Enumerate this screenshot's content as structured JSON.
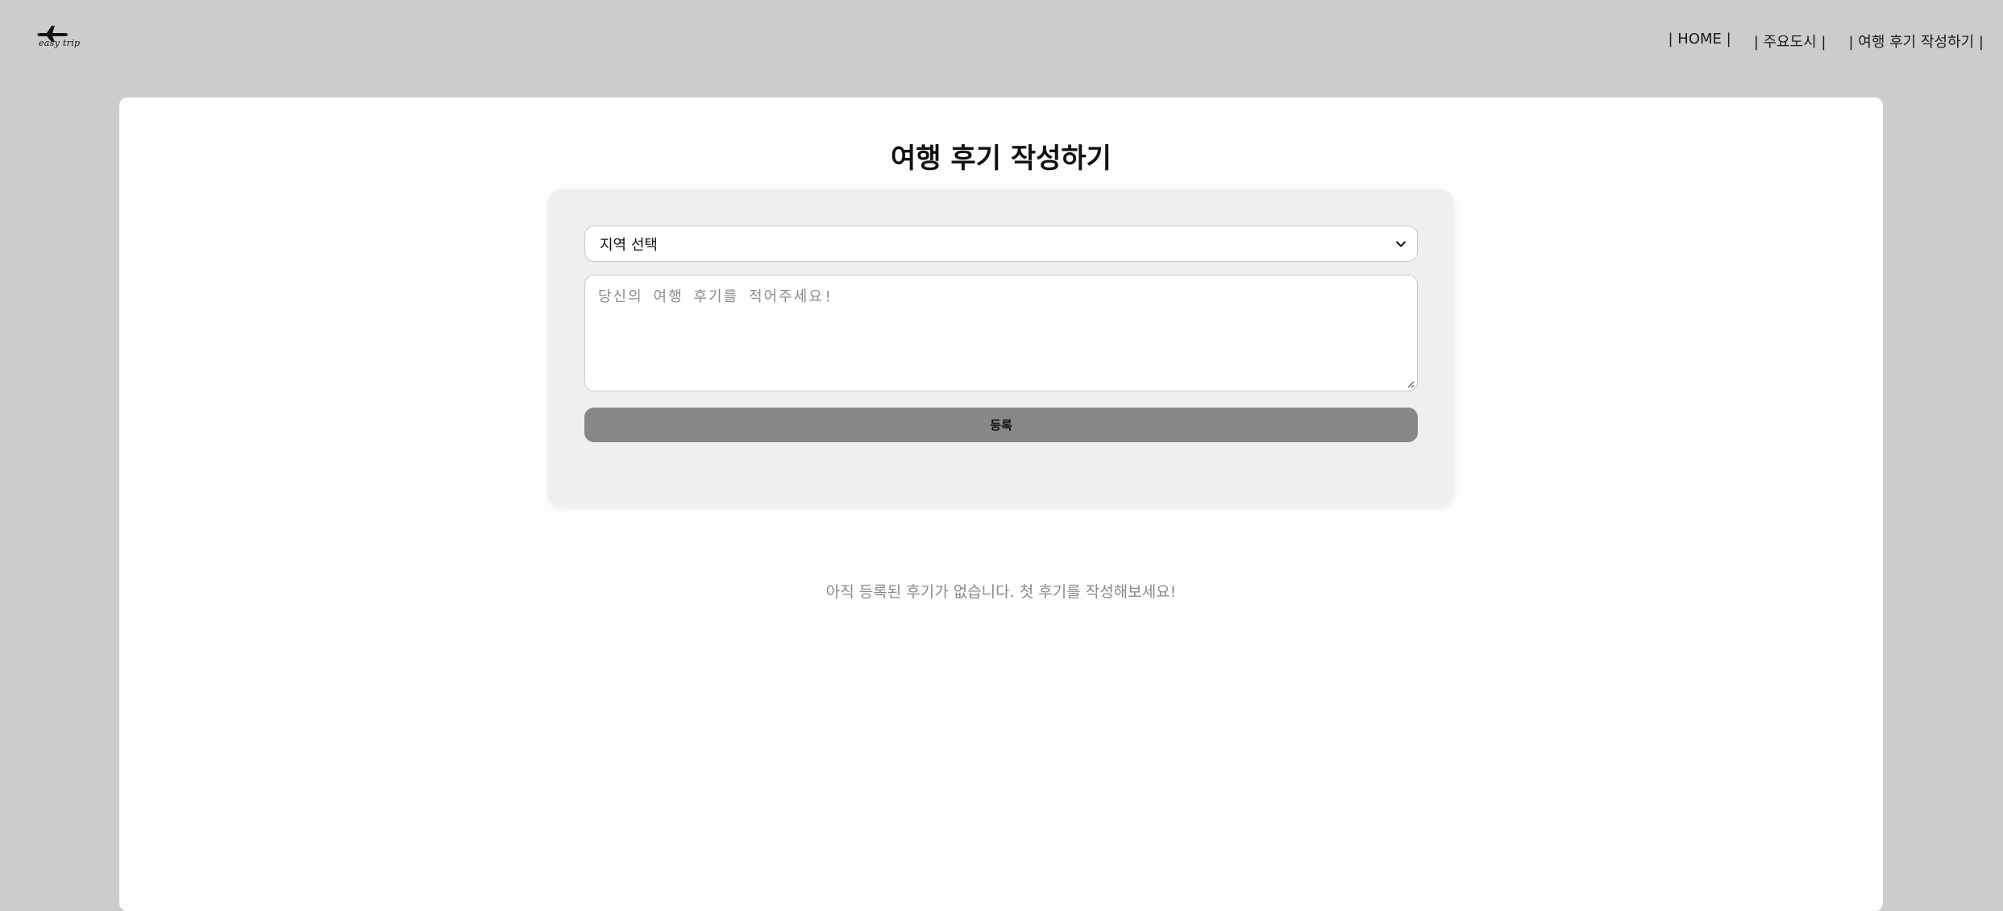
{
  "header": {
    "logo_text": "easy trip",
    "nav": [
      {
        "label": "| HOME |"
      },
      {
        "label": "| 주요도시 |"
      },
      {
        "label": "| 여행 후기 작성하기 |"
      }
    ]
  },
  "main": {
    "title": "여행 후기 작성하기",
    "form": {
      "region_select": {
        "selected": "지역 선택"
      },
      "review_textarea": {
        "placeholder": "당신의 여행 후기를 적어주세요!"
      },
      "submit_label": "등록"
    },
    "empty_message": "아직 등록된 후기가 없습니다. 첫 후기를 작성해보세요!"
  },
  "colors": {
    "page_background": "#cccccc",
    "card_background": "#fdfdfd",
    "form_panel_background": "#efefef",
    "button_background": "#878787",
    "muted_text": "#8a8a8a"
  },
  "icons": [
    "airplane-logo-icon",
    "chevron-down-icon",
    "resize-handle-icon"
  ]
}
